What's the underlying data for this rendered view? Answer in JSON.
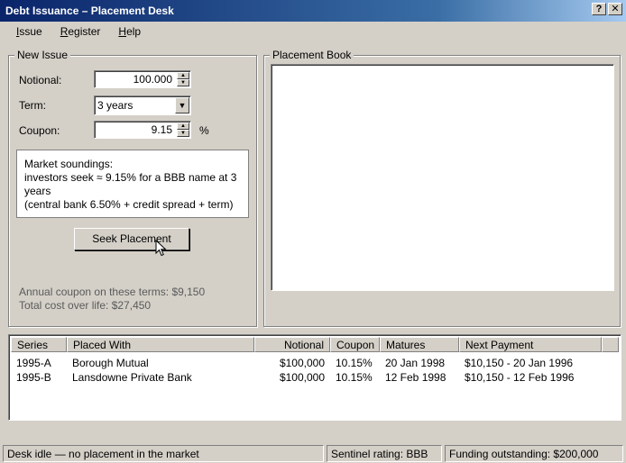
{
  "window": {
    "title": "Debt Issuance – Placement Desk",
    "help_btn": "?",
    "close_btn": "✕"
  },
  "menu": {
    "items": [
      {
        "key": "I",
        "rest": "ssue"
      },
      {
        "key": "R",
        "rest": "egister"
      },
      {
        "key": "H",
        "rest": "elp"
      }
    ]
  },
  "new_issue": {
    "title": "New Issue",
    "notional_label": "Notional:",
    "notional_value": "100.000",
    "term_label": "Term:",
    "term_value": "3 years",
    "coupon_label": "Coupon:",
    "coupon_value": "9.15",
    "coupon_unit": "%",
    "soundings": {
      "line1": "Market soundings:",
      "line2": "investors seek ≈ 9.15% for a BBB name at 3 years",
      "line3": "(central bank 6.50% + credit spread + term)"
    },
    "seek_button": "Seek Placement",
    "annual_coupon": "Annual coupon on these terms: $9,150",
    "total_cost": "Total cost over life: $27,450"
  },
  "placement_book": {
    "title": "Placement Book"
  },
  "register": {
    "columns": [
      "Series",
      "Placed With",
      "Notional",
      "Coupon",
      "Matures",
      "Next Payment"
    ],
    "rows": [
      {
        "series": "1995-A",
        "placed_with": "Borough Mutual",
        "notional": "$100,000",
        "coupon": "10.15%",
        "matures": "20 Jan 1998",
        "next_payment": "$10,150 - 20 Jan 1996"
      },
      {
        "series": "1995-B",
        "placed_with": "Lansdowne Private Bank",
        "notional": "$100,000",
        "coupon": "10.15%",
        "matures": "12 Feb 1998",
        "next_payment": "$10,150 - 12 Feb 1996"
      }
    ]
  },
  "status": {
    "desk": "Desk idle — no placement in the market",
    "rating": "Sentinel rating: BBB",
    "funding": "Funding outstanding: $200,000"
  }
}
